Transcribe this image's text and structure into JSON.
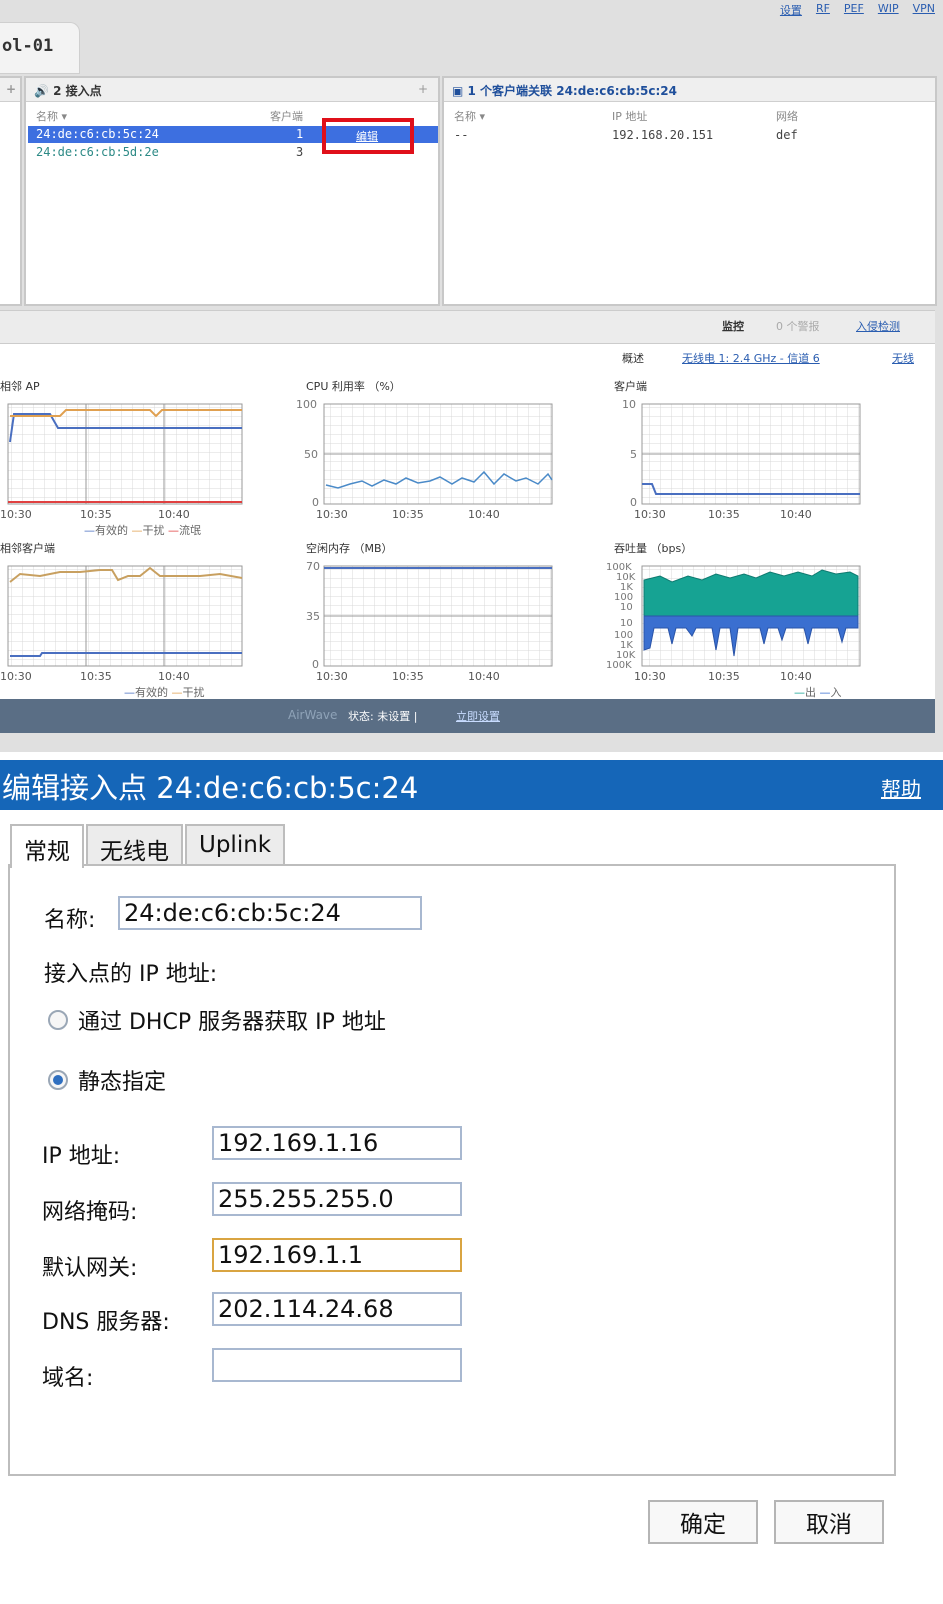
{
  "top_links": [
    "设置",
    "RF",
    "PEF",
    "WIP",
    "VPN"
  ],
  "controller_tab": "ol-01",
  "ap_panel": {
    "title": "2 接入点",
    "columns": [
      "名称 ▾",
      "客户端"
    ],
    "rows": [
      {
        "name": "24:de:c6:cb:5c:24",
        "clients": "1"
      },
      {
        "name": "24:de:c6:cb:5d:2e",
        "clients": "3"
      }
    ],
    "edit_label": "编辑"
  },
  "client_panel": {
    "title": "1 个客户端关联 24:de:c6:cb:5c:24",
    "columns": [
      "名称 ▾",
      "IP 地址",
      "网络"
    ],
    "rows": [
      {
        "name": "--",
        "ip": "192.168.20.151",
        "network": "def"
      }
    ]
  },
  "monitor_bar": {
    "monitor": "监控",
    "alarms": "0 个警报",
    "intrusion": "入侵检测"
  },
  "overview_bar": {
    "overview": "概述",
    "radio": "无线电 1: 2.4 GHz - 信道 6",
    "more": "无线"
  },
  "charts_text": {
    "neighbor_ap_title": "相邻 AP",
    "neighbor_ap_legend": [
      "有效的",
      "干扰",
      "流氓"
    ],
    "neighbor_client_title": "相邻客户端",
    "neighbor_client_legend": [
      "有效的",
      "干扰"
    ],
    "cpu_title": "CPU 利用率 （%）",
    "mem_title": "空闲内存 （MB）",
    "clients_title": "客户端",
    "throughput_title": "吞吐量 （bps）",
    "throughput_legend": [
      "出",
      "入"
    ],
    "time_ticks": [
      "10:30",
      "10:35",
      "10:40"
    ]
  },
  "chart_data": [
    {
      "type": "line",
      "title": "相邻 AP",
      "x": [
        "10:30",
        "10:35",
        "10:40"
      ],
      "ylim": [
        0,
        10
      ],
      "series": [
        {
          "name": "有效的",
          "values": [
            10,
            7,
            7
          ]
        },
        {
          "name": "干扰",
          "values": [
            9,
            10,
            10
          ]
        },
        {
          "name": "流氓",
          "values": [
            0,
            0,
            0
          ]
        }
      ]
    },
    {
      "type": "line",
      "title": "CPU 利用率 （%）",
      "x": [
        "10:30",
        "10:35",
        "10:40"
      ],
      "ylim": [
        0,
        100
      ],
      "yticks": [
        "100",
        "50",
        "0"
      ],
      "series": [
        {
          "values": [
            15,
            25,
            25
          ]
        }
      ]
    },
    {
      "type": "line",
      "title": "客户端",
      "x": [
        "10:30",
        "10:35",
        "10:40"
      ],
      "ylim": [
        0,
        10
      ],
      "yticks": [
        "10",
        "5",
        "0"
      ],
      "series": [
        {
          "values": [
            2,
            1,
            1
          ]
        }
      ]
    },
    {
      "type": "line",
      "title": "相邻客户端",
      "x": [
        "10:30",
        "10:35",
        "10:40"
      ],
      "series": [
        {
          "name": "有效的",
          "values": [
            1,
            1,
            1
          ]
        },
        {
          "name": "干扰",
          "values": [
            9,
            10,
            9
          ]
        }
      ]
    },
    {
      "type": "line",
      "title": "空闲内存 （MB）",
      "x": [
        "10:30",
        "10:35",
        "10:40"
      ],
      "ylim": [
        0,
        70
      ],
      "yticks": [
        "70",
        "35",
        "0"
      ],
      "series": [
        {
          "values": [
            68,
            68,
            68
          ]
        }
      ]
    },
    {
      "type": "area",
      "title": "吞吐量 （bps）",
      "x": [
        "10:30",
        "10:35",
        "10:40"
      ],
      "ylim": [
        "-100K",
        "100K"
      ],
      "yticks": [
        "100K",
        "10K",
        "1K",
        "100",
        "10",
        "10",
        "100",
        "1K",
        "10K",
        "100K"
      ],
      "series": [
        {
          "name": "出",
          "color": "#1aa89a"
        },
        {
          "name": "入",
          "color": "#3a6fd0"
        }
      ]
    }
  ],
  "status": {
    "brand": "AirWave",
    "text": "状态: 未设置 |",
    "link": "立即设置"
  },
  "dialog": {
    "title": "编辑接入点 24:de:c6:cb:5c:24",
    "help": "帮助",
    "tabs": [
      "常规",
      "无线电",
      "Uplink"
    ],
    "name_label": "名称:",
    "name_value": "24:de:c6:cb:5c:24",
    "ip_section_label": "接入点的 IP 地址:",
    "radio_dhcp": "通过 DHCP 服务器获取 IP 地址",
    "radio_static": "静态指定",
    "ip_label": "IP 地址:",
    "ip_value": "192.169.1.16",
    "mask_label": "网络掩码:",
    "mask_value": "255.255.255.0",
    "gateway_label": "默认网关:",
    "gateway_value": "192.169.1.1",
    "dns_label": "DNS 服务器:",
    "dns_value": "202.114.24.68",
    "domain_label": "域名:",
    "domain_value": "",
    "ok": "确定",
    "cancel": "取消"
  }
}
